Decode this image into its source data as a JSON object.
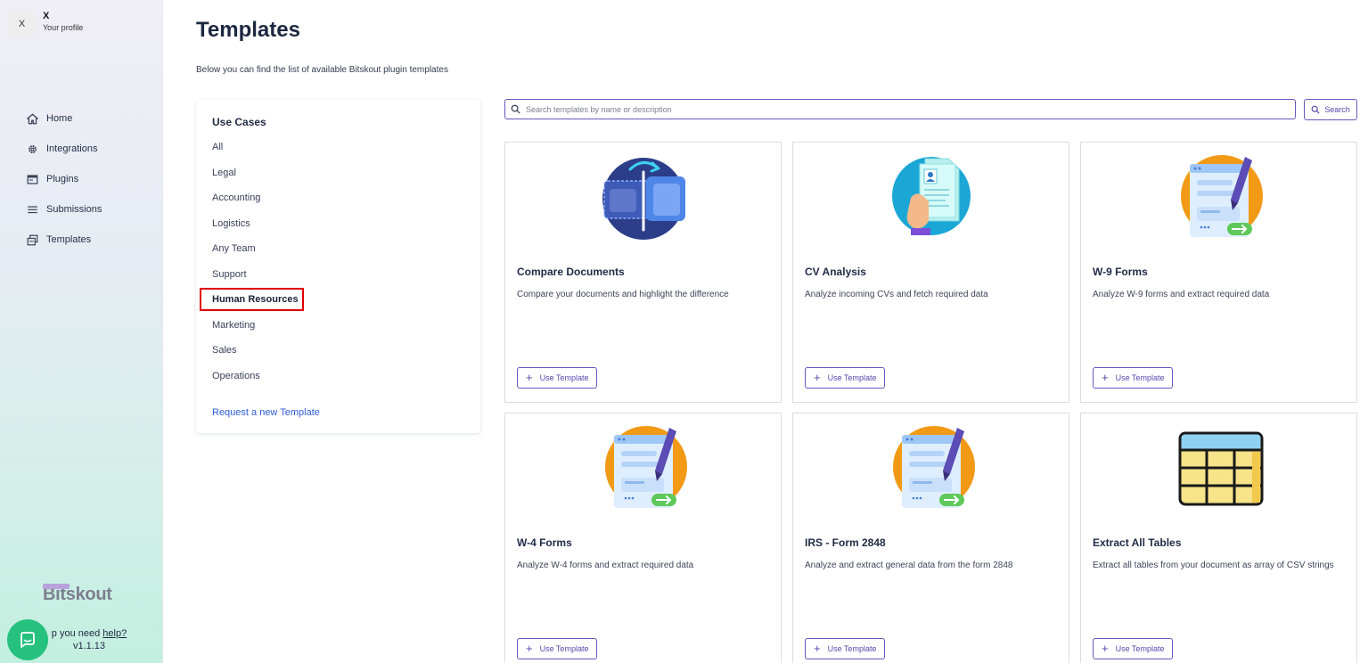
{
  "profile": {
    "avatar_initial": "X",
    "name": "X",
    "subtitle": "Your profile"
  },
  "nav": [
    {
      "label": "Home",
      "icon": "home-icon"
    },
    {
      "label": "Integrations",
      "icon": "gear-icon"
    },
    {
      "label": "Plugins",
      "icon": "window-icon"
    },
    {
      "label": "Submissions",
      "icon": "list-icon"
    },
    {
      "label": "Templates",
      "icon": "templates-icon"
    }
  ],
  "brand": {
    "logo": "Bitskout"
  },
  "help": {
    "prefix": "p you need ",
    "link": "help?",
    "version": "v1.1.13"
  },
  "page": {
    "title": "Templates",
    "subtitle": "Below you can find the list of available Bitskout plugin templates"
  },
  "use_cases": {
    "title": "Use Cases",
    "items": [
      "All",
      "Legal",
      "Accounting",
      "Logistics",
      "Any Team",
      "Support",
      "Human Resources",
      "Marketing",
      "Sales",
      "Operations"
    ],
    "active": "Human Resources",
    "request_link": "Request a new Template"
  },
  "search": {
    "placeholder": "Search templates by name or description",
    "value": "",
    "button_label": "Search"
  },
  "templates": [
    {
      "title": "Compare Documents",
      "description": "Compare your documents and highlight the difference",
      "button": "Use Template",
      "icon": "compare-documents-icon"
    },
    {
      "title": "CV Analysis",
      "description": "Analyze incoming CVs and fetch required data",
      "button": "Use Template",
      "icon": "cv-analysis-icon"
    },
    {
      "title": "W-9 Forms",
      "description": "Analyze W-9 forms and extract required data",
      "button": "Use Template",
      "icon": "form-pen-icon"
    },
    {
      "title": "W-4 Forms",
      "description": "Analyze W-4 forms and extract required data",
      "button": "Use Template",
      "icon": "form-pen-icon"
    },
    {
      "title": "IRS - Form 2848",
      "description": "Analyze and extract general data from the form 2848",
      "button": "Use Template",
      "icon": "form-pen-icon"
    },
    {
      "title": "Extract All Tables",
      "description": "Extract all tables from your document as array of CSV strings",
      "button": "Use Template",
      "icon": "table-icon"
    }
  ],
  "colors": {
    "accent": "#6d55c0",
    "highlight": "#e00000",
    "chat": "#27c17e",
    "link": "#2d5bd6"
  }
}
